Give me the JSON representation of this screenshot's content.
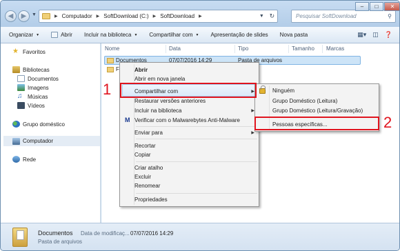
{
  "address": {
    "segments": [
      "Computador",
      "SoftDownload (C:)",
      "SoftDownload"
    ],
    "search_placeholder": "Pesquisar SoftDownload"
  },
  "window_controls": {
    "minimize": "–",
    "maximize": "□",
    "close": "✕"
  },
  "toolbar": {
    "organize": "Organizar",
    "open": "Abrir",
    "include_library": "Incluir na biblioteca",
    "share_with": "Compartilhar com",
    "slideshow": "Apresentação de slides",
    "new_folder": "Nova pasta"
  },
  "sidebar": {
    "favorites": "Favoritos",
    "libraries": "Bibliotecas",
    "documents": "Documentos",
    "images": "Imagens",
    "music": "Músicas",
    "videos": "Vídeos",
    "homegroup": "Grupo doméstico",
    "computer": "Computador",
    "network": "Rede"
  },
  "columns": {
    "name": "Nome",
    "date": "Data",
    "type": "Tipo",
    "size": "Tamanho",
    "tags": "Marcas"
  },
  "files": [
    {
      "name": "Documentos",
      "date": "07/07/2016 14:29",
      "type": "Pasta de arquivos"
    },
    {
      "name": "Fo"
    }
  ],
  "context_menu": {
    "open": "Abrir",
    "open_new_window": "Abrir em nova janela",
    "share_with": "Compartilhar com",
    "restore_versions": "Restaurar versões anteriores",
    "include_library": "Incluir na biblioteca",
    "malwarebytes": "Verificar com o Malwarebytes Anti-Malware",
    "send_to": "Enviar para",
    "cut": "Recortar",
    "copy": "Copiar",
    "create_shortcut": "Criar atalho",
    "delete": "Excluir",
    "rename": "Renomear",
    "properties": "Propriedades"
  },
  "submenu": {
    "nobody": "Ninguém",
    "homegroup_read": "Grupo Doméstico (Leitura)",
    "homegroup_readwrite": "Grupo Doméstico (Leitura/Gravação)",
    "specific_people": "Pessoas específicas..."
  },
  "annotations": {
    "step1": "1",
    "step2": "2"
  },
  "details": {
    "name": "Documentos",
    "modified_label": "Data de modificaç...",
    "modified_value": "07/07/2016 14:29",
    "type": "Pasta de arquivos"
  },
  "colors": {
    "highlight": "#e0141e",
    "selection": "#cde4f7",
    "accent": "#6d8fb0"
  }
}
